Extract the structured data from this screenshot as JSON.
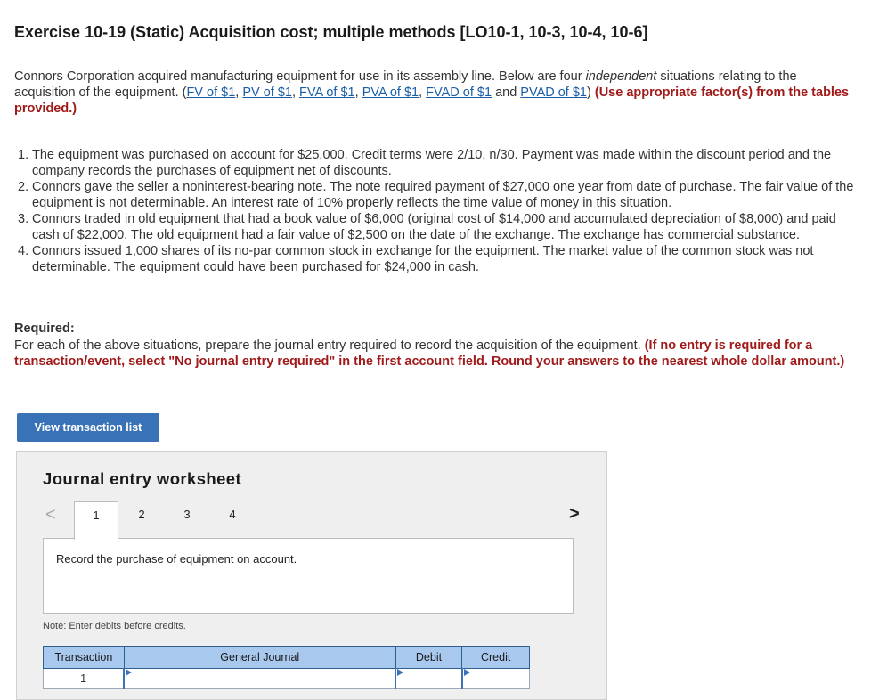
{
  "header": {
    "title": "Exercise 10-19 (Static) Acquisition cost; multiple methods [LO10-1, 10-3, 10-4, 10-6]"
  },
  "intro": {
    "text_before": "Connors Corporation acquired manufacturing equipment for use in its assembly line. Below are four ",
    "emphasis": "independent",
    "text_after": " situations relating to the acquisition of the equipment. (",
    "links": [
      "FV of $1",
      "PV of $1",
      "FVA of $1",
      "PVA of $1",
      "FVAD of $1",
      "PVAD of $1"
    ],
    "sep1": ", ",
    "and_text": " and ",
    "close_paren": ")",
    "instruction": " (Use appropriate factor(s) from the tables provided.)"
  },
  "situations": [
    {
      "number": "1.",
      "text": "The equipment was purchased on account for $25,000. Credit terms were 2/10, n/30. Payment was made within the discount period and the company records the purchases of equipment net of discounts."
    },
    {
      "number": "2.",
      "text": "Connors gave the seller a noninterest-bearing note. The note required payment of $27,000 one year from date of purchase. The fair value of the equipment is not determinable. An interest rate of 10% properly reflects the time value of money in this situation."
    },
    {
      "number": "3.",
      "text": "Connors traded in old equipment that had a book value of $6,000 (original cost of $14,000 and accumulated depreciation of $8,000) and paid cash of $22,000. The old equipment had a fair value of $2,500 on the date of the exchange. The exchange has commercial substance."
    },
    {
      "number": "4.",
      "text": "Connors issued 1,000 shares of its no-par common stock in exchange for the equipment. The market value of the common stock was not determinable. The equipment could have been purchased for $24,000 in cash."
    }
  ],
  "required": {
    "heading": "Required:",
    "text": "For each of the above situations, prepare the journal entry required to record the acquisition of the equipment. ",
    "instruction": "(If no entry is required for a transaction/event, select \"No journal entry required\" in the first account field. Round your answers to the nearest whole dollar amount.)"
  },
  "buttons": {
    "view_transactions": "View transaction list"
  },
  "worksheet": {
    "title": "Journal entry worksheet",
    "prev_glyph": "<",
    "next_glyph": ">",
    "tabs": [
      "1",
      "2",
      "3",
      "4"
    ],
    "active_tab": "1",
    "description": "Record the purchase of equipment on account.",
    "note": "Note: Enter debits before credits.",
    "columns": [
      "Transaction",
      "General Journal",
      "Debit",
      "Credit"
    ],
    "rows": [
      {
        "transaction": "1",
        "account": "",
        "debit": "",
        "credit": ""
      }
    ]
  },
  "colors": {
    "button": "#3a72b8",
    "link": "#1a5ea8",
    "instruction_red": "#a01a1a",
    "table_header": "#a8c8ee"
  }
}
